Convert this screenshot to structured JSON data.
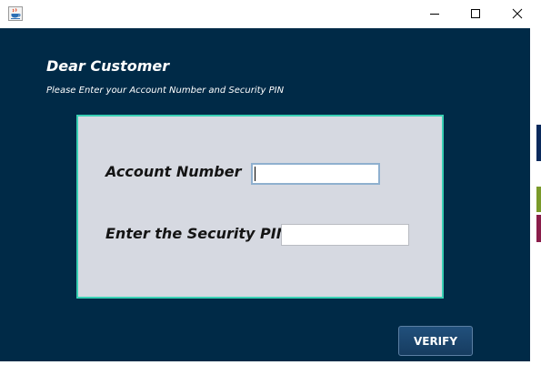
{
  "window": {
    "icon": "java-cup-icon",
    "controls": [
      "minimize-icon",
      "maximize-icon",
      "close-icon"
    ]
  },
  "main": {
    "heading": "Dear Customer",
    "subheading": "Please Enter your Account Number and Security PIN"
  },
  "form": {
    "account_label": "Account Number",
    "account_value": "",
    "pin_label": "Enter the Security PIN",
    "pin_value": "",
    "border_color": "#39d0b4",
    "background_color": "#d6d9e1"
  },
  "actions": {
    "verify_label": "VERIFY"
  },
  "colors": {
    "background": "#002a47",
    "button": "#1c4a72"
  }
}
